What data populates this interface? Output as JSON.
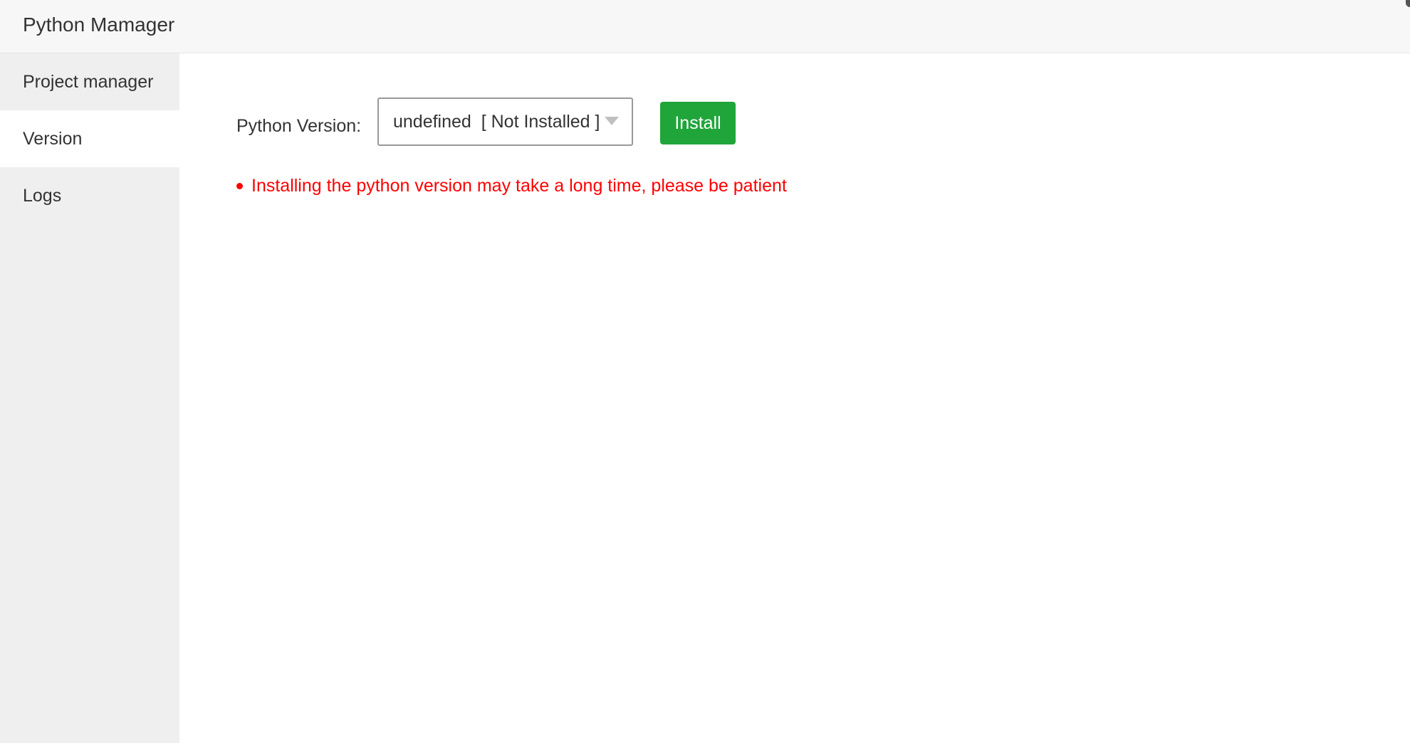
{
  "app": {
    "title": "Python Mamager"
  },
  "sidebar": {
    "items": [
      {
        "label": "Project manager",
        "active": false
      },
      {
        "label": "Version",
        "active": true
      },
      {
        "label": "Logs",
        "active": false
      }
    ]
  },
  "main": {
    "version_label": "Python Version:",
    "version_select": {
      "selected": "undefined  [ Not Installed ]"
    },
    "install_label": "Install",
    "tip": "Installing the python version may take a long time, please be patient"
  },
  "colors": {
    "accent_green": "#20a53a",
    "warning_red": "#ff0000",
    "sidebar_bg": "#efefef",
    "titlebar_bg": "#f7f7f7"
  },
  "icons": {
    "select_arrow": "chevron-down-icon",
    "tip_bullet": "bullet-icon"
  }
}
